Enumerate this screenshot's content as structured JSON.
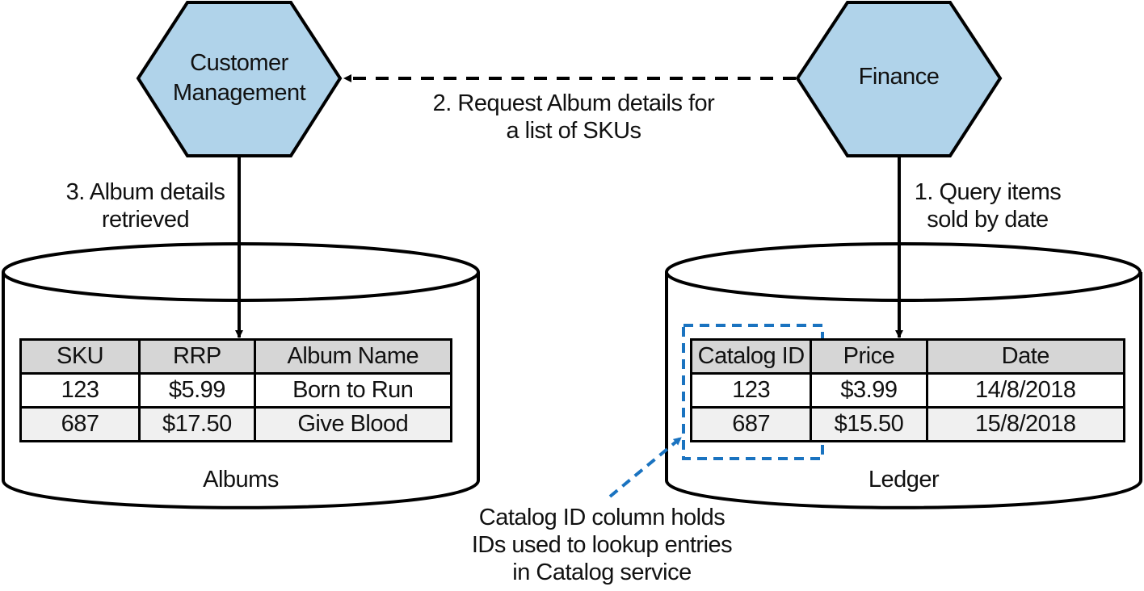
{
  "services": {
    "customer_management": {
      "line1": "Customer",
      "line2": "Management"
    },
    "finance": {
      "line1": "Finance"
    }
  },
  "arrows": {
    "step1": {
      "line1": "1. Query items",
      "line2": "sold by date"
    },
    "step2": {
      "line1": "2. Request Album details for",
      "line2": "a list of SKUs"
    },
    "step3": {
      "line1": "3. Album details",
      "line2": "retrieved"
    }
  },
  "databases": {
    "albums": {
      "name": "Albums",
      "columns": [
        "SKU",
        "RRP",
        "Album Name"
      ],
      "rows": [
        [
          "123",
          "$5.99",
          "Born to Run"
        ],
        [
          "687",
          "$17.50",
          "Give Blood"
        ]
      ]
    },
    "ledger": {
      "name": "Ledger",
      "columns": [
        "Catalog ID",
        "Price",
        "Date"
      ],
      "rows": [
        [
          "123",
          "$3.99",
          "14/8/2018"
        ],
        [
          "687",
          "$15.50",
          "15/8/2018"
        ]
      ]
    }
  },
  "annotation": {
    "line1": "Catalog ID column holds",
    "line2": "IDs used to lookup entries",
    "line3": "in Catalog service"
  },
  "colors": {
    "service_fill": "#b0d3ea",
    "highlight": "#1a73c0",
    "header_fill": "#d6d6d6",
    "alt_row_fill": "#f0f0f0"
  }
}
